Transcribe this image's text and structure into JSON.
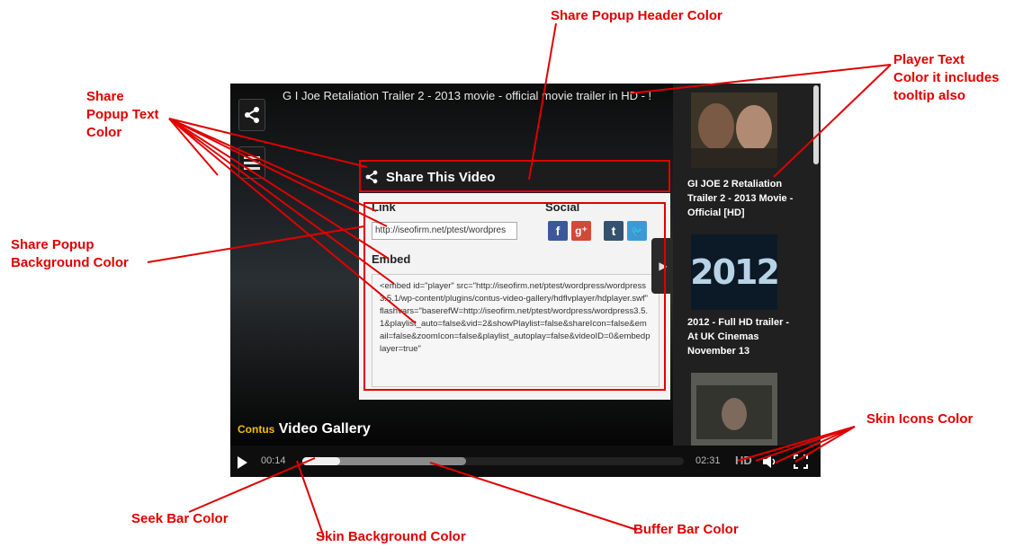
{
  "annotations": {
    "share_header_color": "Share Popup Header Color",
    "player_text_color": "Player Text\nColor it includes\ntooltip also",
    "share_text_color": "Share\nPopup Text\nColor",
    "share_background_color": "Share Popup\nBackground Color",
    "skin_icons_color": "Skin Icons Color",
    "seek_bar_color": "Seek Bar Color",
    "skin_background_color": "Skin Background Color",
    "buffer_bar_color": "Buffer Bar Color"
  },
  "player": {
    "video_title": "G I Joe Retaliation Trailer 2 - 2013 movie - official movie trailer in HD - !",
    "logo_brand": "Contus",
    "logo_product": "Video Gallery"
  },
  "share": {
    "header_title": "Share This Video",
    "link_label": "Link",
    "link_value": "http://iseofirm.net/ptest/wordpres",
    "social_label": "Social",
    "embed_label": "Embed",
    "embed_code": "<embed id=\"player\" src=\"http://iseofirm.net/ptest/wordpress/wordpress3.5.1/wp-content/plugins/contus-video-gallery/hdflvplayer/hdplayer.swf\" flashvars=\"baserefW=http://iseofirm.net/ptest/wordpress/wordpress3.5.1&playlist_auto=false&vid=2&showPlaylist=false&shareIcon=false&email=false&zoomIcon=false&playlist_autoplay=false&videoID=0&embedplayer=true\"",
    "social_icons": [
      {
        "name": "facebook-icon",
        "glyph": "f",
        "color": "#3b5998"
      },
      {
        "name": "google-plus-icon",
        "glyph": "g⁺",
        "color": "#d34836"
      },
      {
        "name": "tumblr-icon",
        "glyph": "t",
        "color": "#34526f"
      },
      {
        "name": "twitter-icon",
        "glyph": "🐦",
        "color": "#3a9ad9"
      }
    ]
  },
  "playlist": [
    {
      "title": "GI JOE 2 Retaliation Trailer 2 - 2013 Movie - Official [HD]"
    },
    {
      "title": "2012 - Full HD trailer - At UK Cinemas November 13",
      "thumb_text": "2012"
    },
    {
      "title": ""
    }
  ],
  "controls": {
    "current_time": "00:14",
    "duration": "02:31",
    "hd_label": "HD",
    "progress_fraction": 0.1,
    "buffer_fraction": 0.43
  }
}
